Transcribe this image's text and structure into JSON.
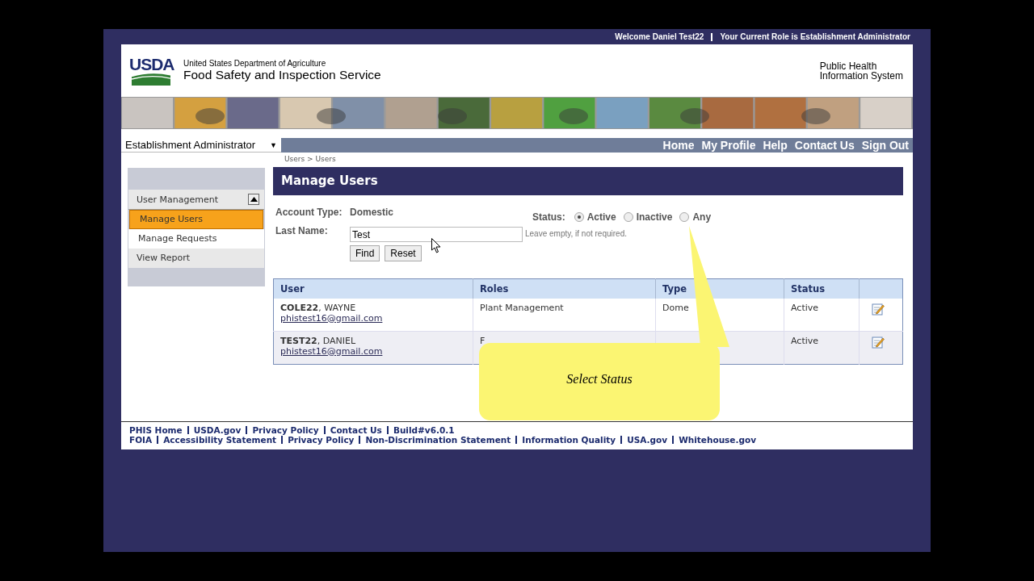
{
  "top_bar": {
    "welcome": "Welcome Daniel Test22",
    "role": "Your Current Role is Establishment Administrator"
  },
  "header": {
    "logo": "USDA",
    "agency_line": "United States Department of Agriculture",
    "agency": "Food Safety and Inspection Service",
    "system": [
      "Public Health",
      "Information System"
    ]
  },
  "nav": {
    "role_select": "Establishment Administrator",
    "caret": "▼",
    "links": [
      "Home",
      "My Profile",
      "Help",
      "Contact Us",
      "Sign Out"
    ]
  },
  "breadcrumb": "Users > Users",
  "sidebar": {
    "section": "User Management",
    "expanded": true,
    "items": [
      {
        "label": "Manage Users",
        "selected": true
      },
      {
        "label": "Manage Requests",
        "selected": false
      },
      {
        "label": "View Report",
        "selected": false
      }
    ]
  },
  "page_title": "Manage Users",
  "form": {
    "account_type_label": "Account Type:",
    "account_type": "Domestic",
    "last_name_label": "Last Name:",
    "last_name": "Test",
    "hint": "Leave empty, if not required.",
    "status_label": "Status:",
    "status_options": [
      {
        "label": "Active",
        "selected": true
      },
      {
        "label": "Inactive",
        "selected": false
      },
      {
        "label": "Any",
        "selected": false
      }
    ],
    "buttons": [
      "Find",
      "Reset"
    ]
  },
  "table": {
    "columns": [
      "User",
      "Roles",
      "Type",
      "Status"
    ],
    "rows": [
      {
        "user": "**COLE22**, WAYNE",
        "email": "phistest16@gmail.com",
        "roles": "Plant Management",
        "type": "Dome",
        "status": "Active"
      },
      {
        "user": "**TEST22**, DANIEL",
        "email": "phistest16@gmail.com",
        "roles": "F",
        "type": "",
        "status": "Active"
      }
    ]
  },
  "callout": "Select Status",
  "footer": {
    "lines": [
      [
        "PHIS Home",
        "USDA.gov",
        "Privacy Policy",
        "Contact Us",
        "Build#v6.0.1"
      ],
      [
        "FOIA",
        "Accessibility Statement",
        "Privacy Policy",
        "Non-Discrimination Statement",
        "Information Quality",
        "USA.gov",
        "Whitehouse.gov"
      ]
    ]
  }
}
